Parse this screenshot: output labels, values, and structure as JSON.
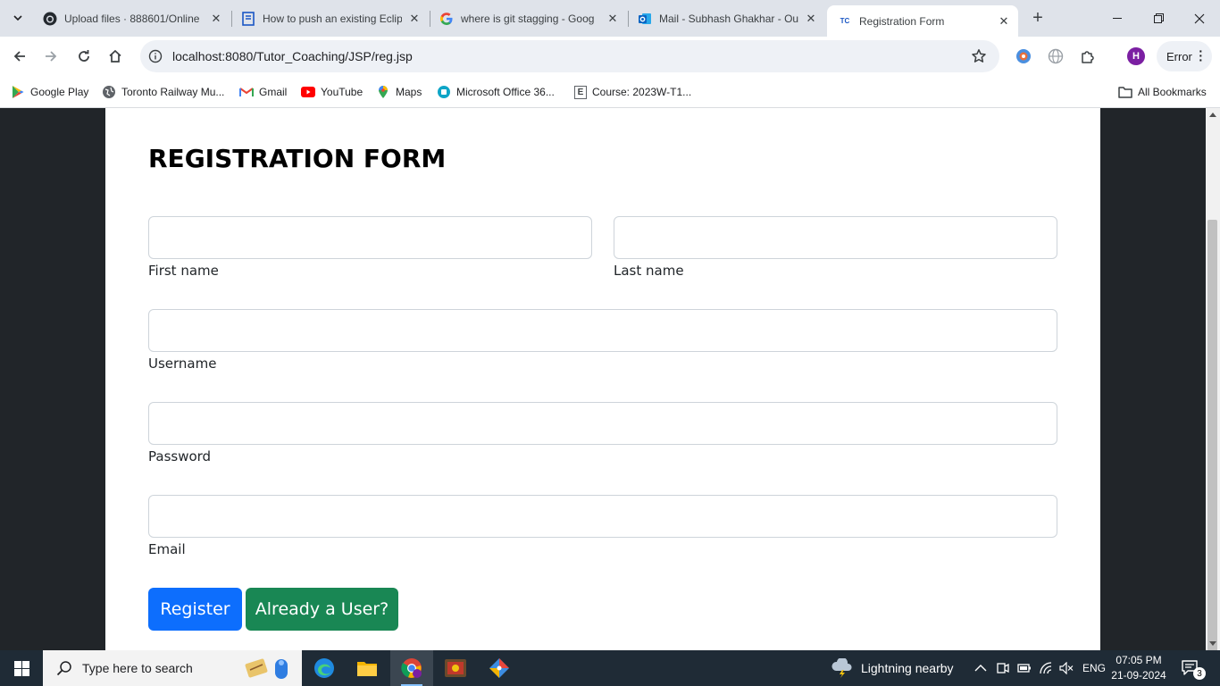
{
  "browser": {
    "tabs": [
      {
        "title": "Upload files · 888601/Online",
        "icon": "github-icon"
      },
      {
        "title": "How to push an existing Eclip",
        "icon": "document-icon"
      },
      {
        "title": "where is git stagging - Goog",
        "icon": "google-icon"
      },
      {
        "title": "Mail - Subhash Ghakhar - Ou",
        "icon": "outlook-icon"
      },
      {
        "title": "Registration Form",
        "icon": "site-icon",
        "active": true
      }
    ],
    "url": "localhost:8080/Tutor_Coaching/JSP/reg.jsp",
    "profile_initial": "H",
    "error_label": "Error",
    "bookmarks": [
      {
        "label": "Google Play",
        "icon": "google-play-icon"
      },
      {
        "label": "Toronto Railway Mu...",
        "icon": "globe-icon"
      },
      {
        "label": "Gmail",
        "icon": "gmail-icon"
      },
      {
        "label": "YouTube",
        "icon": "youtube-icon"
      },
      {
        "label": "Maps",
        "icon": "maps-icon"
      },
      {
        "label": "Microsoft Office 36...",
        "icon": "office-icon"
      },
      {
        "label": "Course: 2023W-T1...",
        "icon": "course-icon"
      }
    ],
    "all_bookmarks_label": "All Bookmarks"
  },
  "form": {
    "title": "REGISTRATION FORM",
    "fields": {
      "first_name": {
        "label": "First name",
        "value": ""
      },
      "last_name": {
        "label": "Last name",
        "value": ""
      },
      "username": {
        "label": "Username",
        "value": ""
      },
      "password": {
        "label": "Password",
        "value": ""
      },
      "email": {
        "label": "Email",
        "value": ""
      }
    },
    "register_label": "Register",
    "login_label": "Already a User?"
  },
  "taskbar": {
    "search_placeholder": "Type here to search",
    "weather": "Lightning nearby",
    "language": "ENG",
    "time": "07:05 PM",
    "date": "21-09-2024",
    "notification_count": "3"
  },
  "colors": {
    "primary": "#0d6efd",
    "success": "#198754",
    "page_background": "#212529"
  }
}
